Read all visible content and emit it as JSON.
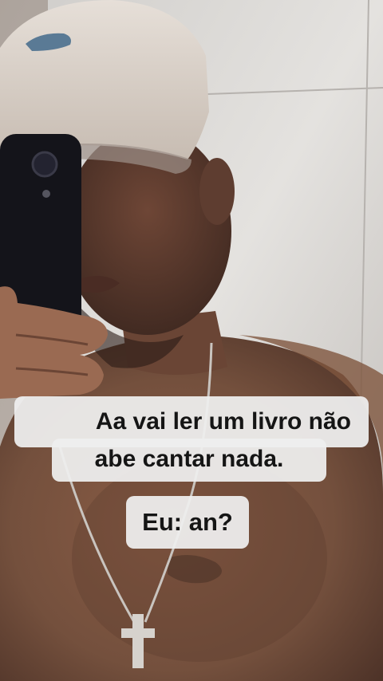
{
  "captions": {
    "line1": "Aa vai ler um livro não",
    "line2": "abe cantar nada.",
    "reply": "Eu: an?"
  },
  "colors": {
    "skin": "#7a503c",
    "wall": "#d8d6d3",
    "cap": "#ddd6cf",
    "phone": "#14141a",
    "caption_bg": "#eeeeee",
    "caption_text": "#151515"
  },
  "icons": {
    "cap_logo": "crocodile-logo-icon",
    "pendant": "cross-pendant-icon"
  }
}
